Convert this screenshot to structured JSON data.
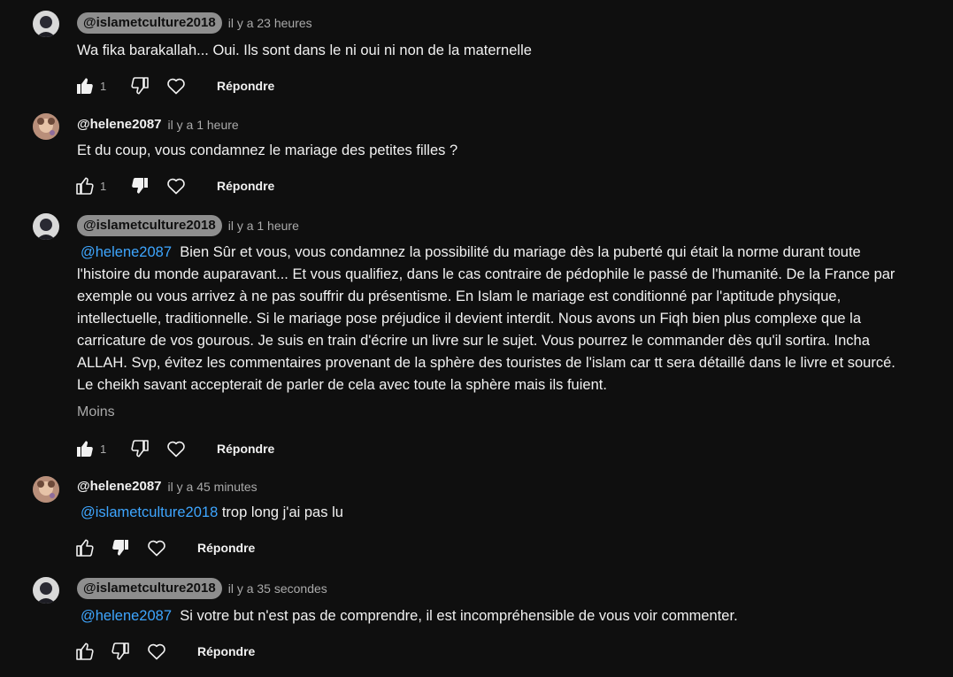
{
  "comments": [
    {
      "author": "@islametculture2018",
      "time": "il y a 23 heures",
      "text": "Wa fika barakallah... Oui. Ils sont dans le ni oui ni non de la maternelle",
      "likes": "1",
      "reply_label": "Répondre",
      "liked": true,
      "disliked": false
    },
    {
      "author": "@helene2087",
      "time": "il y a 1 heure",
      "text": "Et du coup, vous condamnez le mariage des petites filles ?",
      "likes": "1",
      "reply_label": "Répondre",
      "liked": false,
      "disliked": true
    },
    {
      "author": "@islametculture2018",
      "time": "il y a 1 heure",
      "mention": "@helene2087",
      "lines": [
        "Bien Sûr et vous, vous condamnez la possibilité du mariage dès la puberté qui était la norme durant toute",
        "l'histoire du monde auparavant... Et vous qualifiez, dans le cas contraire de pédophile le passé de l'humanité. De la France par",
        "exemple ou vous arrivez à ne pas souffrir du présentisme. En Islam le mariage est conditionné par l'aptitude physique,",
        "intellectuelle, traditionnelle. Si le mariage pose préjudice il devient interdit. Nous avons un Fiqh bien plus complexe que la",
        "carricature de vos gourous. Je suis en train d'écrire un livre sur le sujet. Vous pourrez le commander dès qu'il sortira. Incha",
        "ALLAH. Svp, évitez les commentaires provenant de la sphère des touristes de l'islam car tt sera détaillé dans le livre et sourcé.",
        "Le cheikh savant accepterait de parler de cela avec toute la sphère mais ils fuient."
      ],
      "less_label": "Moins",
      "likes": "1",
      "reply_label": "Répondre",
      "liked": true,
      "disliked": false
    },
    {
      "author": "@helene2087",
      "time": "il y a 45 minutes",
      "mention": "@islametculture2018",
      "text": "trop long j'ai pas lu",
      "reply_label": "Répondre",
      "liked": false,
      "disliked": true
    },
    {
      "author": "@islametculture2018",
      "time": "il y a 35 secondes",
      "mention": "@helene2087",
      "text": "Si votre but n'est pas de comprendre, il est incompréhensible de vous voir commenter.",
      "reply_label": "Répondre",
      "liked": false,
      "disliked": false
    }
  ],
  "icons": {
    "like": "thumbs-up-icon",
    "dislike": "thumbs-down-icon",
    "heart": "heart-icon"
  },
  "colors": {
    "background": "#0f0f0f",
    "mention": "#3ea6ff",
    "author_pill": "#8e8e8e",
    "muted": "#aaaaaa"
  }
}
